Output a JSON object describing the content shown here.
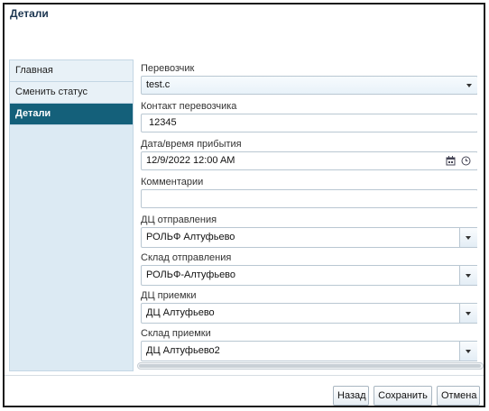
{
  "dialog": {
    "title": "Детали"
  },
  "sidebar": {
    "items": [
      {
        "label": "Главная",
        "active": false
      },
      {
        "label": "Сменить статус",
        "active": false
      },
      {
        "label": "Детали",
        "active": true
      }
    ]
  },
  "form": {
    "carrier": {
      "label": "Перевозчик",
      "value": "test.c"
    },
    "carrier_contact": {
      "label": "Контакт перевозчика",
      "value": "12345"
    },
    "arrival": {
      "label": "Дата/время прибытия",
      "value": "12/9/2022 12:00 AM"
    },
    "comments": {
      "label": "Комментарии",
      "value": ""
    },
    "dc_departure": {
      "label": "ДЦ отправления",
      "value": "РОЛЬФ Алтуфьево"
    },
    "warehouse_departure": {
      "label": "Склад отправления",
      "value": "РОЛЬФ-Алтуфьево"
    },
    "dc_receiving": {
      "label": "ДЦ приемки",
      "value": "ДЦ Алтуфьево"
    },
    "warehouse_receiving": {
      "label": "Склад приемки",
      "value": "ДЦ Алтуфьево2"
    }
  },
  "icons": [
    "calendar-icon",
    "clock-icon",
    "chevron-down-icon"
  ],
  "footer": {
    "back_label": "Назад",
    "save_label": "Сохранить",
    "cancel_label": "Отмена"
  },
  "colors": {
    "active_tab": "#14607a",
    "sidebar_bg": "#dceaf3",
    "title_text": "#1b3550"
  }
}
